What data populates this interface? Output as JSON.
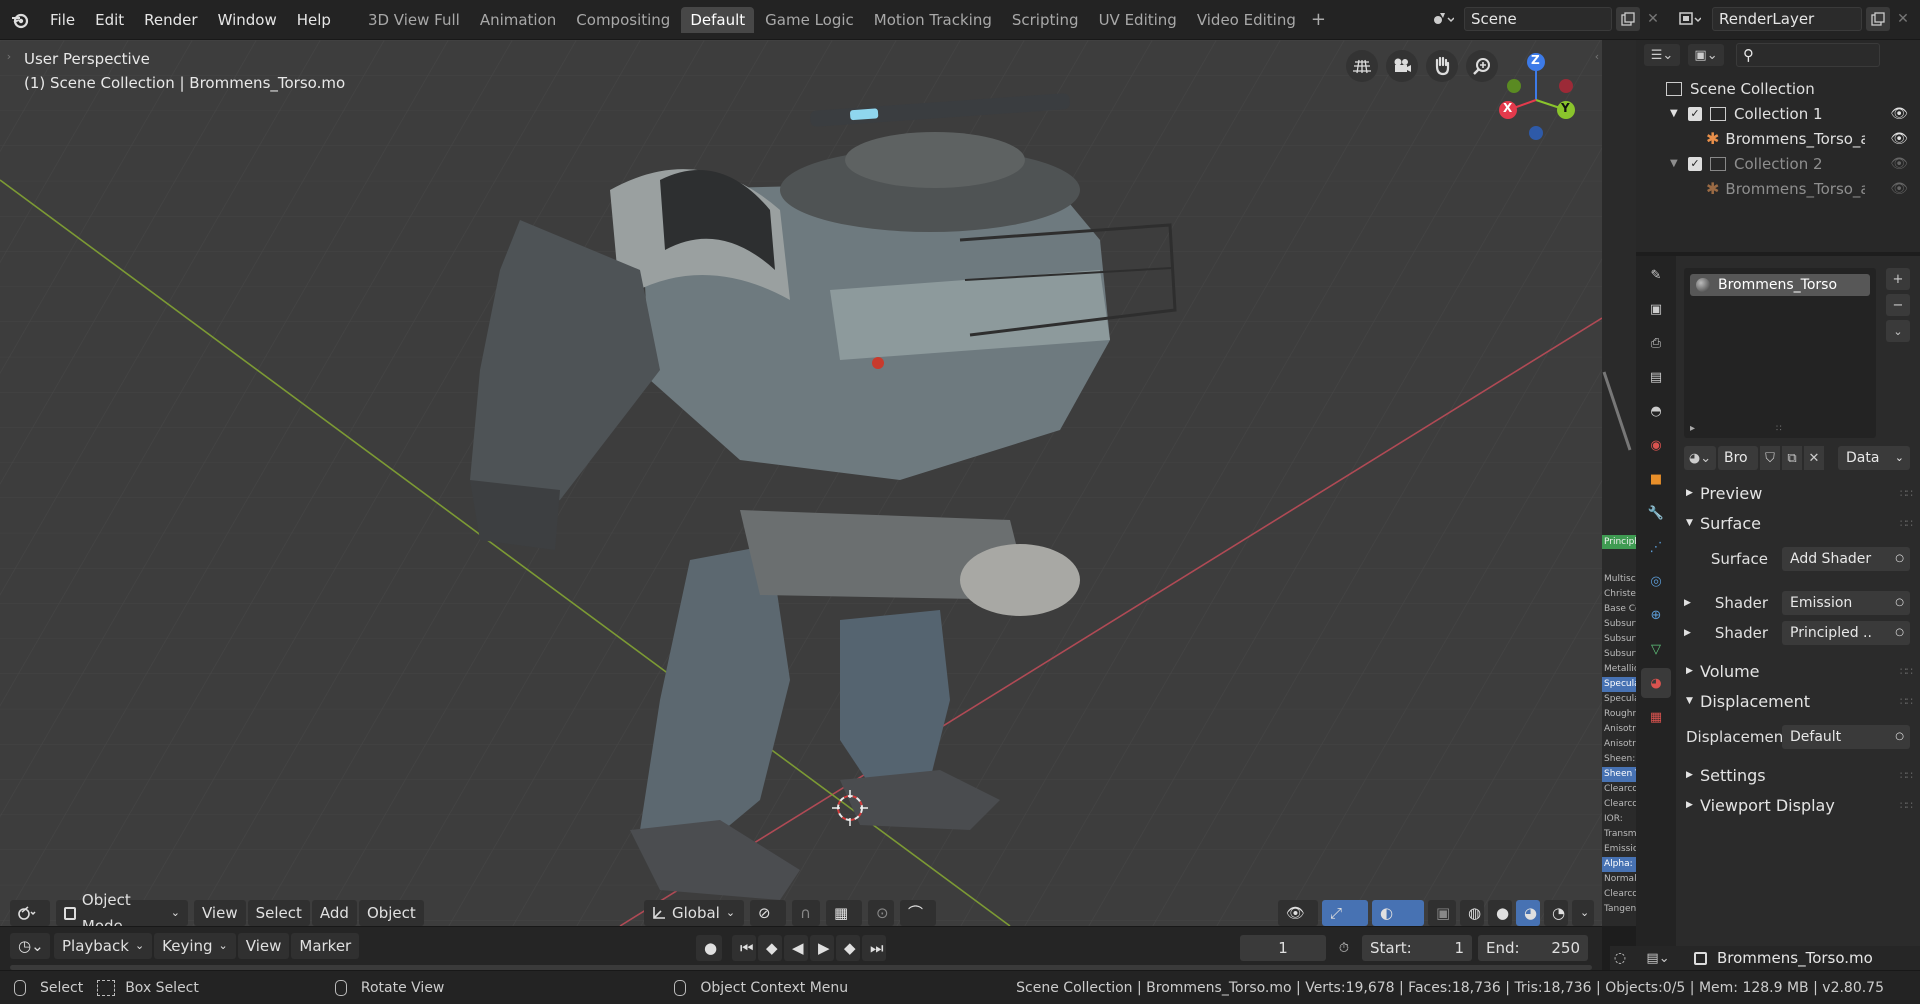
{
  "menu": [
    "File",
    "Edit",
    "Render",
    "Window",
    "Help"
  ],
  "workspaces": [
    {
      "label": "3D View Full",
      "active": false
    },
    {
      "label": "Animation",
      "active": false
    },
    {
      "label": "Compositing",
      "active": false
    },
    {
      "label": "Default",
      "active": true
    },
    {
      "label": "Game Logic",
      "active": false
    },
    {
      "label": "Motion Tracking",
      "active": false
    },
    {
      "label": "Scripting",
      "active": false
    },
    {
      "label": "UV Editing",
      "active": false
    },
    {
      "label": "Video Editing",
      "active": false
    }
  ],
  "add_workspace": "+",
  "scene_name": "Scene",
  "render_layer": "RenderLayer",
  "viewport": {
    "perspective": "User Perspective",
    "context": "(1) Scene Collection | Brommens_Torso.mo",
    "gizmo": {
      "z": "Z",
      "y": "Y",
      "x": "X"
    },
    "header": {
      "mode": "Object Mode",
      "menus": [
        "View",
        "Select",
        "Add",
        "Object"
      ],
      "transform": "Global"
    }
  },
  "node_strip": {
    "header": "Principle",
    "items": [
      {
        "label": "Multiscat",
        "hl": false
      },
      {
        "label": "Christens",
        "hl": false
      },
      {
        "label": "Base Col",
        "hl": false
      },
      {
        "label": "Subsurfa",
        "hl": false
      },
      {
        "label": "Subsurfa",
        "hl": false
      },
      {
        "label": "Subsurf..",
        "hl": false
      },
      {
        "label": "Metallic",
        "hl": false
      },
      {
        "label": "Specula",
        "hl": true
      },
      {
        "label": "Specula",
        "hl": false
      },
      {
        "label": "Roughne",
        "hl": false
      },
      {
        "label": "Anisotro",
        "hl": false
      },
      {
        "label": "Anisotro",
        "hl": false
      },
      {
        "label": "Sheen:",
        "hl": false
      },
      {
        "label": "Sheen T",
        "hl": true
      },
      {
        "label": "Clearcoa",
        "hl": false
      },
      {
        "label": "Clearcoa",
        "hl": false
      },
      {
        "label": "IOR:",
        "hl": false
      },
      {
        "label": "Transmi",
        "hl": false
      },
      {
        "label": "Emission",
        "hl": false
      },
      {
        "label": "Alpha:",
        "hl": true
      },
      {
        "label": "Normal",
        "hl": false
      },
      {
        "label": "Clearcoa",
        "hl": false
      },
      {
        "label": "Tangent",
        "hl": false
      }
    ]
  },
  "outliner": {
    "rows": [
      {
        "label": "Scene Collection",
        "dim": false
      },
      {
        "label": "Collection 1",
        "dim": false
      },
      {
        "label": "Brommens_Torso_arm",
        "dim": false
      },
      {
        "label": "Collection 2",
        "dim": true
      },
      {
        "label": "Brommens_Torso_arm",
        "dim": true
      }
    ]
  },
  "material": {
    "slot": "Brommens_Torso",
    "datablock": "Bro",
    "data_mode": "Data",
    "panels": {
      "preview": "Preview",
      "surface": "Surface",
      "volume": "Volume",
      "displacement": "Displacement",
      "settings": "Settings",
      "viewport_display": "Viewport Display"
    },
    "rows": [
      {
        "label": "Surface",
        "value": "Add Shader"
      },
      {
        "label": "Shader",
        "value": "Emission"
      },
      {
        "label": "Shader",
        "value": "Principled .."
      },
      {
        "label": "Displacement",
        "value": "Default"
      }
    ]
  },
  "props_footer": "Brommens_Torso.mo",
  "timeline": {
    "menus": [
      "Playback",
      "Keying",
      "View",
      "Marker"
    ],
    "current_frame": "1",
    "start_label": "Start:",
    "start": "1",
    "end_label": "End:",
    "end": "250"
  },
  "status": {
    "select": "Select",
    "box_select": "Box Select",
    "rotate": "Rotate View",
    "context_menu": "Object Context Menu",
    "stats": "Scene Collection | Brommens_Torso.mo | Verts:19,678 | Faces:18,736 | Tris:18,736 | Objects:0/5 | Mem: 128.9 MB | v2.80.75"
  },
  "colors": {
    "accent": "#4772b3",
    "x_axis": "#e43a4c",
    "y_axis": "#8ac42c",
    "z_axis": "#3d7be8",
    "viewport_bg": "#3d3d3d"
  }
}
